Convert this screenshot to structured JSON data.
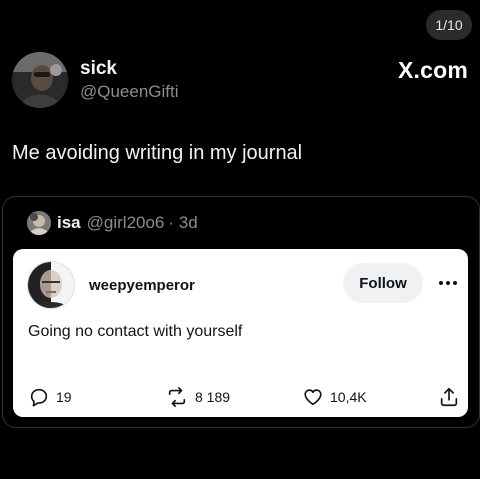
{
  "viewer": {
    "counter": "1/10",
    "brand": "X.com"
  },
  "tweet": {
    "author_name": "sick",
    "author_handle": "@QueenGifti",
    "text": "Me avoiding writing in my journal"
  },
  "quoted": {
    "author_name": "isa",
    "author_handle": "@girl20o6",
    "time": "· 3d",
    "inner": {
      "author_name": "weepyemperor",
      "follow_label": "Follow",
      "text": "Going no contact with yourself",
      "actions": {
        "replies": "19",
        "reposts": "8 189",
        "likes": "10,4K"
      }
    }
  },
  "icons": {
    "reply": "reply-icon",
    "repost": "repost-icon",
    "like": "heart-icon",
    "share": "share-icon",
    "more": "more-icon"
  }
}
